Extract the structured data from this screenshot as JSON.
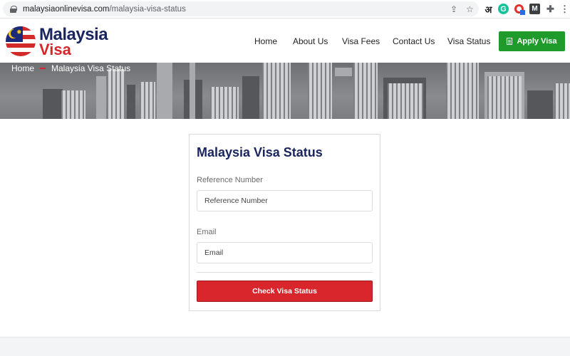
{
  "browser": {
    "url_host": "malaysiaonlinevisa.com",
    "url_path": "/malaysia-visa-status",
    "icons": [
      "lock-icon",
      "share-icon",
      "star-icon",
      "hindi-extension-icon",
      "grammarly-icon",
      "extension-badge-icon",
      "m-extension-icon",
      "puzzle-icon",
      "menu-icon"
    ],
    "hindi_glyph": "अ",
    "grammarly_glyph": "G",
    "m_glyph": "M"
  },
  "logo": {
    "line1": "Malaysia",
    "line2": "Visa",
    "colors": {
      "navy": "#1a2660",
      "red": "#d6262b",
      "gold": "#f7c629"
    }
  },
  "nav": {
    "items": [
      {
        "label": "Home"
      },
      {
        "label": "About Us"
      },
      {
        "label": "Visa Fees"
      },
      {
        "label": "Contact Us"
      },
      {
        "label": "Visa Status"
      }
    ],
    "apply_label": "Apply Visa",
    "apply_color": "#1f9b2c"
  },
  "breadcrumb": {
    "home": "Home",
    "current": "Malaysia Visa Status"
  },
  "form": {
    "title": "Malaysia Visa Status",
    "reference_label": "Reference Number",
    "reference_placeholder": "Reference Number",
    "email_label": "Email",
    "email_placeholder": "Email",
    "submit_label": "Check Visa Status",
    "submit_color": "#d8262c"
  }
}
